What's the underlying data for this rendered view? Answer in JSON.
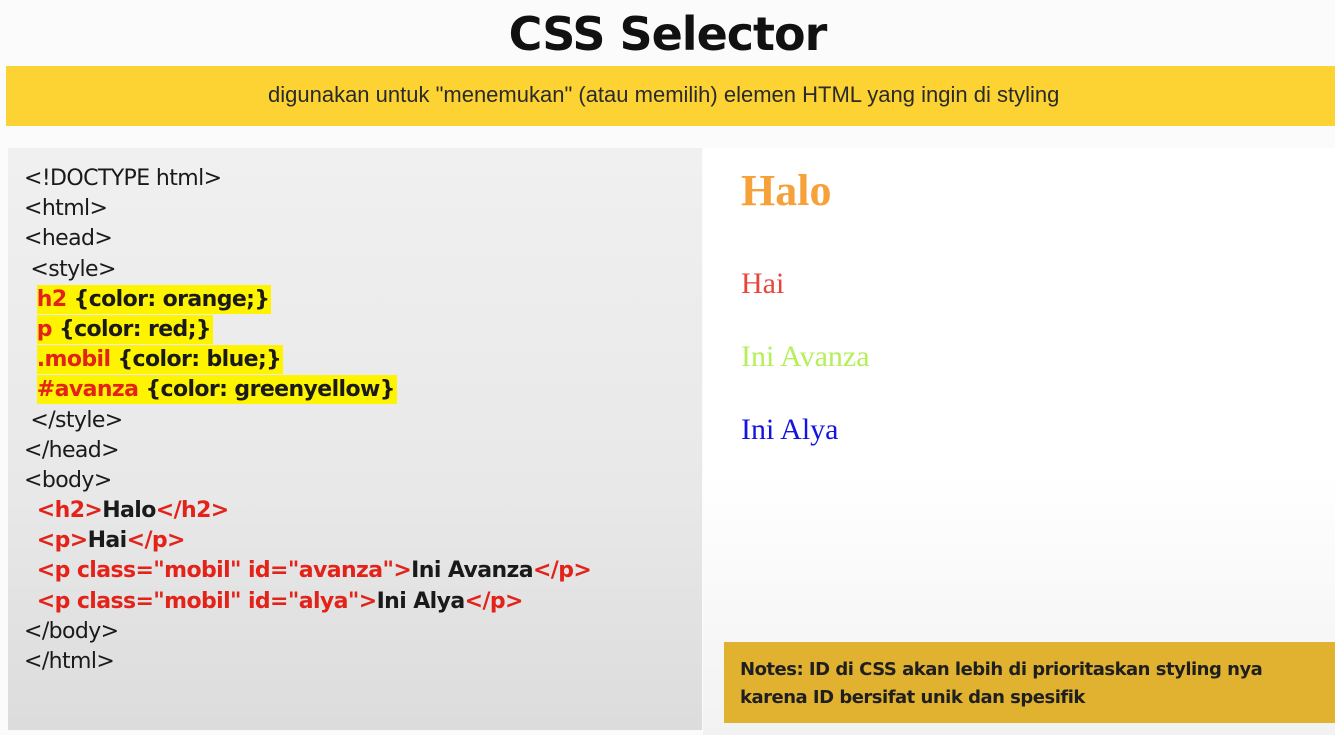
{
  "title": "CSS Selector",
  "banner": {
    "text": "digunakan untuk \"menemukan\" (atau memilih) elemen HTML yang ingin di styling"
  },
  "code": {
    "doctype": "<!DOCTYPE html>",
    "html_open": "<html>",
    "head_open": "<head>",
    "style_open": " <style>",
    "rules": [
      {
        "selector": "h2",
        "declaration": " {color: orange;}"
      },
      {
        "selector": "p",
        "declaration": " {color: red;}"
      },
      {
        "selector": ".mobil",
        "declaration": " {color: blue;}"
      },
      {
        "selector": "#avanza",
        "declaration": " {color: greenyellow}"
      }
    ],
    "style_close": " </style>",
    "head_close": "</head>",
    "body_open": "<body>",
    "body_lines": [
      {
        "open": "<h2>",
        "text": "Halo",
        "close": "</h2>"
      },
      {
        "open": "<p>",
        "text": "Hai",
        "close": "</p>"
      },
      {
        "open": "<p class=\"mobil\" id=\"avanza\">",
        "text": "Ini Avanza",
        "close": "</p>"
      },
      {
        "open": "<p class=\"mobil\" id=\"alya\">",
        "text": "Ini Alya",
        "close": "</p>"
      }
    ],
    "body_close": "</body>",
    "html_close": "</html>"
  },
  "preview": {
    "heading": "Halo",
    "p1": "Hai",
    "p2": "Ini Avanza",
    "p3": "Ini Alya"
  },
  "notes": {
    "line1": "Notes: ID di CSS akan lebih di prioritaskan styling nya",
    "line2": "karena ID bersifat unik dan spesifik"
  },
  "colors": {
    "banner": "#fcd333",
    "highlight": "#fff400",
    "code_red": "#e3231a",
    "preview_orange": "#f6a13a",
    "preview_red": "#e8453c",
    "preview_greenyellow": "#b5ef5a",
    "preview_blue": "#1414e0",
    "notes": "#e1b230"
  }
}
